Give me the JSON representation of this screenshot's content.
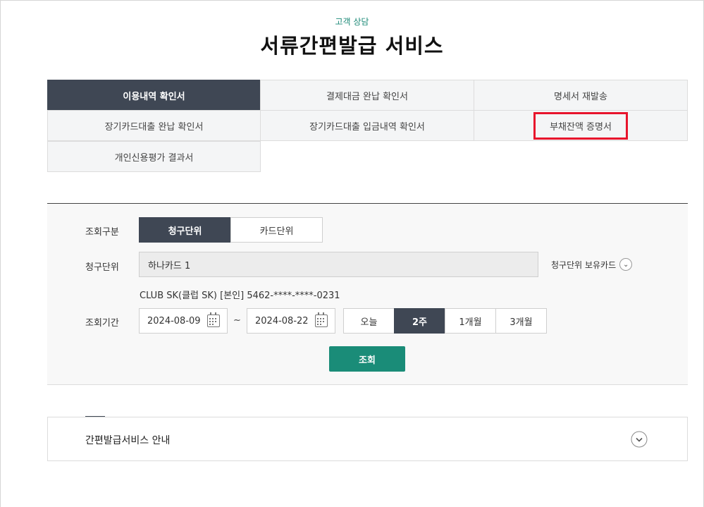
{
  "header": {
    "subtitle": "고객 상담",
    "title": "서류간편발급 서비스"
  },
  "tabs": [
    {
      "label": "이용내역 확인서",
      "active": true
    },
    {
      "label": "결제대금 완납 확인서",
      "active": false
    },
    {
      "label": "명세서 재발송",
      "active": false
    },
    {
      "label": "장기카드대출 완납 확인서",
      "active": false
    },
    {
      "label": "장기카드대출 입금내역 확인서",
      "active": false
    },
    {
      "label": "부채잔액 증명서",
      "active": false,
      "highlighted": true,
      "highlight_color": "#e8142c"
    },
    {
      "label": "개인신용평가 결과서",
      "active": false
    }
  ],
  "form": {
    "query_type": {
      "label": "조회구분",
      "options": [
        "청구단위",
        "카드단위"
      ],
      "selected": "청구단위"
    },
    "billing_unit": {
      "label": "청구단위",
      "value": "하나카드 1",
      "cards_link": "청구단위 보유카드",
      "card_info": "CLUB SK(클럽 SK) [본인] 5462-****-****-0231"
    },
    "period": {
      "label": "조회기간",
      "start": "2024-08-09",
      "separator": "~",
      "end": "2024-08-22",
      "presets": [
        "오늘",
        "2주",
        "1개월",
        "3개월"
      ],
      "selected": "2주"
    },
    "search_button": "조회"
  },
  "guide": {
    "title": "간편발급서비스 안내"
  },
  "colors": {
    "accent_green": "#1a8c78",
    "dark_tab": "#3f4754",
    "highlight_red": "#e8142c"
  }
}
